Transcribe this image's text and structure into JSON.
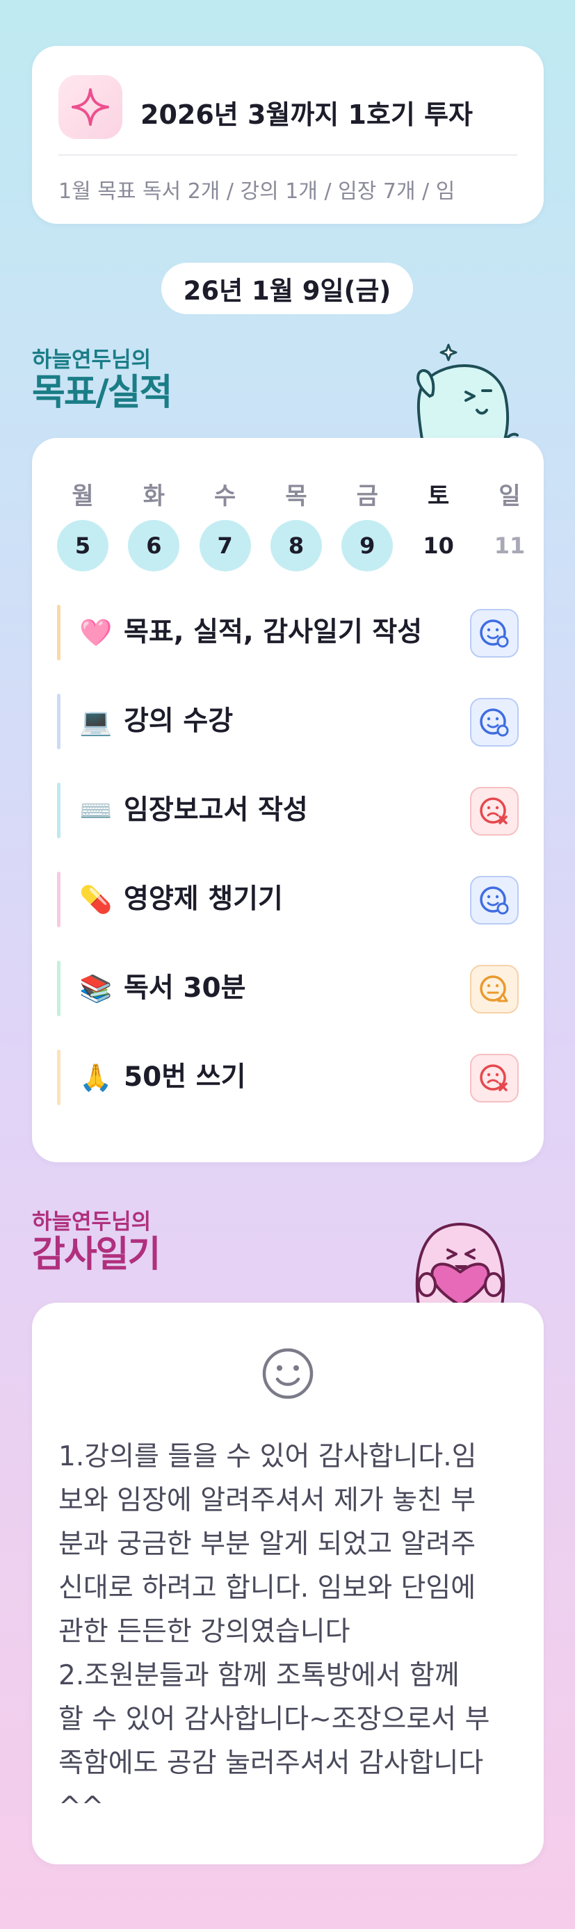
{
  "goal_card": {
    "title": "2026년 3월까지 1호기 투자",
    "subtitle": "1월 목표  독서 2개 / 강의 1개 / 임장 7개 / 임"
  },
  "date": "26년 1월 9일(금)",
  "goals_section": {
    "owner": "하늘연두님의",
    "heading": "목표/실적"
  },
  "week": {
    "days": [
      {
        "name": "월",
        "num": "5",
        "state": "done"
      },
      {
        "name": "화",
        "num": "6",
        "state": "done"
      },
      {
        "name": "수",
        "num": "7",
        "state": "done"
      },
      {
        "name": "목",
        "num": "8",
        "state": "done"
      },
      {
        "name": "금",
        "num": "9",
        "state": "done"
      },
      {
        "name": "토",
        "num": "10",
        "state": "today"
      },
      {
        "name": "일",
        "num": "11",
        "state": "future"
      }
    ]
  },
  "tasks": [
    {
      "emoji": "🩷",
      "label": "목표, 실적, 감사일기 작성",
      "status": "done-icon",
      "bar": "#fbd9a8"
    },
    {
      "emoji": "💻",
      "label": "강의 수강",
      "status": "done-icon",
      "bar": "#cddaf6"
    },
    {
      "emoji": "⌨️",
      "label": "임장보고서 작성",
      "status": "fail-icon",
      "bar": "#bfe8ef"
    },
    {
      "emoji": "💊",
      "label": "영양제 챙기기",
      "status": "done-icon",
      "bar": "#f7c9e2"
    },
    {
      "emoji": "📚",
      "label": "독서 30분",
      "status": "partial-icon",
      "bar": "#c4f0dc"
    },
    {
      "emoji": "🙏",
      "label": "50번 쓰기",
      "status": "fail-icon",
      "bar": "#fbe3b8"
    }
  ],
  "thanks_section": {
    "owner": "하늘연두님의",
    "heading": "감사일기"
  },
  "gratitude": {
    "text": "1.강의를 들을 수 있어 감사합니다.임\n보와 임장에 알려주셔서 제가 놓친 부\n분과 궁금한 부분 알게 되었고 알려주\n신대로 하려고 합니다. 임보와 단임에\n관한 든든한 강의였습니다\n2.조원분들과 함께 조톡방에서 함께\n할 수 있어 감사합니다~조장으로서 부\n족함에도 공감 눌러주셔서 감사합니다\n^^"
  },
  "colors": {
    "goals_accent": "#1a7d86",
    "thanks_accent": "#b0307e",
    "done_day": "#c4edf3"
  }
}
